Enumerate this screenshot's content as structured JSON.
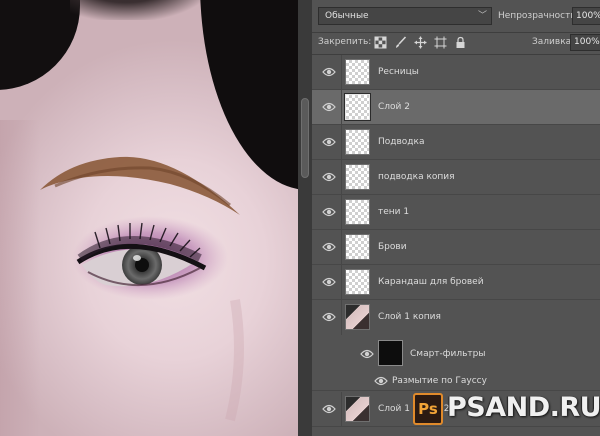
{
  "options_bar": {
    "blend_mode": "Обычные",
    "opacity_label": "Непрозрачность:",
    "opacity_value": "100%",
    "lock_label": "Закрепить:",
    "fill_label": "Заливка:",
    "fill_value": "100%"
  },
  "layers": [
    {
      "name": "Ресницы"
    },
    {
      "name": "Слой 2",
      "selected": true
    },
    {
      "name": "Подводка"
    },
    {
      "name": "подводка копия"
    },
    {
      "name": "тени 1"
    },
    {
      "name": "Брови"
    },
    {
      "name": "Карандаш для бровей"
    },
    {
      "name": "Слой 1 копия",
      "thumbnail": "photo"
    }
  ],
  "smart_filters": {
    "label": "Смарт-фильтры",
    "filter_name": "Размытие по Гауссу"
  },
  "bottom_layer": {
    "name": "Слой 1 копия 2"
  },
  "watermark": {
    "badge": "Ps",
    "text": "PSAND.RU"
  },
  "icons": {
    "eye": "eye-icon",
    "lock_transparent": "checkerboard-lock-icon",
    "lock_image": "brush-icon",
    "lock_position": "move-arrows-icon",
    "lock_artboard": "artboard-icon",
    "lock_all": "lock-icon"
  }
}
